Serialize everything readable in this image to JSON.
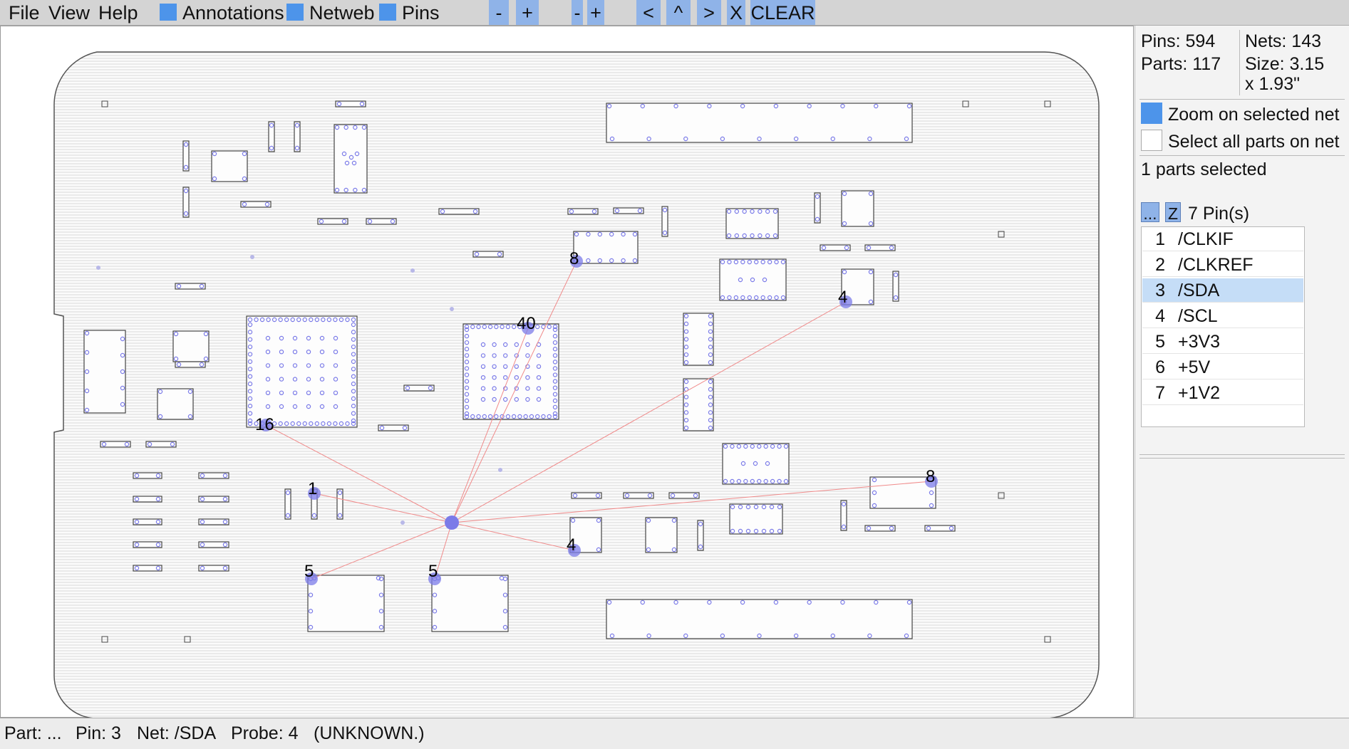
{
  "menu": {
    "file": "File",
    "view": "View",
    "help": "Help"
  },
  "toggles": {
    "annotations": {
      "label": "Annotations",
      "checked": true
    },
    "netweb": {
      "label": "Netweb",
      "checked": true
    },
    "pins": {
      "label": "Pins",
      "checked": true
    }
  },
  "toolbar_buttons": {
    "zoom_out_1": "-",
    "zoom_in_1": "+",
    "zoom_out_2": "-",
    "zoom_in_2": "+",
    "prev": "<",
    "up": "^",
    "next": ">",
    "close": "X",
    "clear": "CLEAR"
  },
  "info": {
    "pins": "Pins: 594",
    "nets": "Nets: 143",
    "parts": "Parts: 117",
    "size_line1": "Size: 3.15",
    "size_line2": "x 1.93\""
  },
  "options": {
    "zoom_on_selected_net": {
      "label": "Zoom on selected net",
      "checked": true
    },
    "select_all_parts_on_net": {
      "label": "Select all parts on net",
      "checked": false
    }
  },
  "selection_summary": "1 parts selected",
  "pin_list_header": {
    "more_button": "...",
    "zoom_button": "Z",
    "count": "7 Pin(s)"
  },
  "pin_list": [
    {
      "num": "1",
      "net": "/CLKIF",
      "selected": false
    },
    {
      "num": "2",
      "net": "/CLKREF",
      "selected": false
    },
    {
      "num": "3",
      "net": "/SDA",
      "selected": true
    },
    {
      "num": "4",
      "net": "/SCL",
      "selected": false
    },
    {
      "num": "5",
      "net": "+3V3",
      "selected": false
    },
    {
      "num": "6",
      "net": "+5V",
      "selected": false
    },
    {
      "num": "7",
      "net": "+1V2",
      "selected": false
    }
  ],
  "board": {
    "netweb_labels": [
      "8",
      "4",
      "40",
      "16",
      "1",
      "4",
      "8",
      "5",
      "5"
    ]
  },
  "status": {
    "part": "Part: ...",
    "pin": "Pin: 3",
    "net": "Net: /SDA",
    "probe": "Probe: 4",
    "state": "(UNKNOWN.)"
  },
  "colors": {
    "accent": "#4d94ea",
    "button": "#8fb3e8",
    "pin": "#7b7be8",
    "netweb": "#f08a8a",
    "selected_row": "#c5ddf7"
  }
}
